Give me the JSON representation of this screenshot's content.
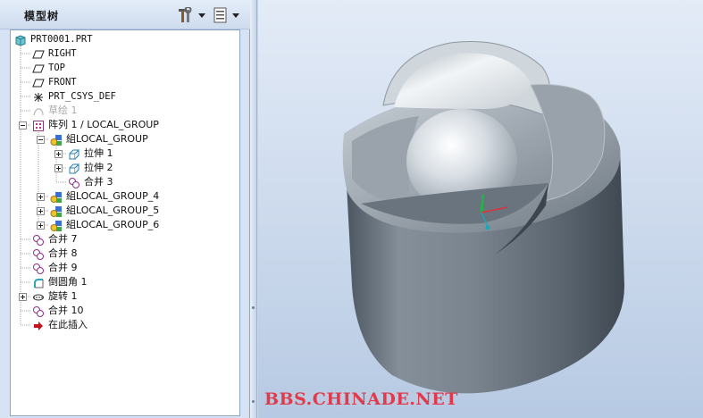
{
  "panel": {
    "title": "模型树",
    "tools_icon": "hammer-wrench-icon",
    "settings_icon": "list-settings-icon"
  },
  "tree": {
    "items": [
      {
        "label": "PRT0001.PRT",
        "icon": "part-cube-icon",
        "expander": "none",
        "dim": false
      },
      {
        "label": "RIGHT",
        "icon": "datum-plane-icon",
        "expander": "none",
        "dim": false
      },
      {
        "label": "TOP",
        "icon": "datum-plane-icon",
        "expander": "none",
        "dim": false
      },
      {
        "label": "FRONT",
        "icon": "datum-plane-icon",
        "expander": "none",
        "dim": false
      },
      {
        "label": "PRT_CSYS_DEF",
        "icon": "coordinate-system-icon",
        "expander": "none",
        "dim": false
      },
      {
        "label": "草绘 1",
        "icon": "sketch-icon",
        "expander": "none",
        "dim": true
      },
      {
        "label": "阵列 1 / LOCAL_GROUP",
        "icon": "pattern-icon",
        "expander": "minus",
        "dim": false
      },
      {
        "label": "組LOCAL_GROUP",
        "icon": "group-icon",
        "expander": "minus",
        "dim": false
      },
      {
        "label": "拉伸 1",
        "icon": "extrude-icon",
        "expander": "plus",
        "dim": false
      },
      {
        "label": "拉伸 2",
        "icon": "extrude-icon",
        "expander": "plus",
        "dim": false
      },
      {
        "label": "合并 3",
        "icon": "merge-icon",
        "expander": "none",
        "dim": false
      },
      {
        "label": "組LOCAL_GROUP_4",
        "icon": "group-icon",
        "expander": "plus",
        "dim": false
      },
      {
        "label": "組LOCAL_GROUP_5",
        "icon": "group-icon",
        "expander": "plus",
        "dim": false
      },
      {
        "label": "組LOCAL_GROUP_6",
        "icon": "group-icon",
        "expander": "plus",
        "dim": false
      },
      {
        "label": "合并 7",
        "icon": "merge-icon",
        "expander": "none",
        "dim": false
      },
      {
        "label": "合并 8",
        "icon": "merge-icon",
        "expander": "none",
        "dim": false
      },
      {
        "label": "合并 9",
        "icon": "merge-icon",
        "expander": "none",
        "dim": false
      },
      {
        "label": "倒圆角 1",
        "icon": "round-icon",
        "expander": "none",
        "dim": false
      },
      {
        "label": "旋转 1",
        "icon": "revolve-icon",
        "expander": "plus",
        "dim": false
      },
      {
        "label": "合并 10",
        "icon": "merge-icon",
        "expander": "none",
        "dim": false
      },
      {
        "label": "在此插入",
        "icon": "insert-here-arrow-icon",
        "expander": "none",
        "dim": false
      }
    ]
  },
  "viewport": {
    "watermark": "BBS.CHINADE.NET",
    "axis_x_color": "#e0313a",
    "axis_y_color": "#23b24a",
    "axis_z_color": "#1aa7b8"
  }
}
